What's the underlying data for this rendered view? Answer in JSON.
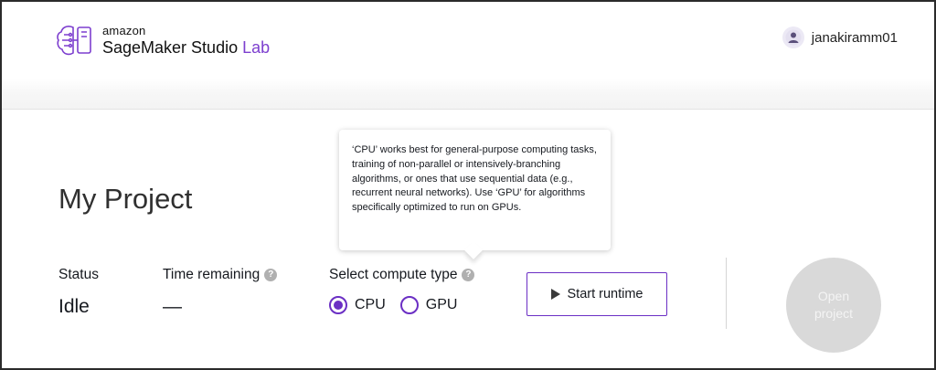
{
  "header": {
    "logo": {
      "amazon": "amazon",
      "product": "SageMaker Studio",
      "lab": "Lab"
    },
    "user": {
      "name": "janakiramm01"
    }
  },
  "project": {
    "title": "My Project",
    "status_label": "Status",
    "status_value": "Idle",
    "time_label": "Time remaining",
    "time_value": "—",
    "compute_label": "Select compute type",
    "compute_options": [
      {
        "label": "CPU",
        "selected": true
      },
      {
        "label": "GPU",
        "selected": false
      }
    ],
    "start_button": "Start runtime",
    "open_button": "Open project"
  },
  "tooltip": {
    "text": "‘CPU’ works best for general-purpose computing tasks, training of non-parallel or intensively-branching algorithms, or ones that use sequential data (e.g., recurrent neural networks). Use ‘GPU’ for algorithms specifically optimized to run on GPUs."
  },
  "colors": {
    "accent": "#6b2fc4",
    "lab": "#7d3fcf",
    "disabled": "#d9d9d9"
  },
  "icons": {
    "logo": "brain-circuit-icon",
    "avatar": "user-avatar-icon",
    "help": "help-icon",
    "play": "play-icon"
  }
}
